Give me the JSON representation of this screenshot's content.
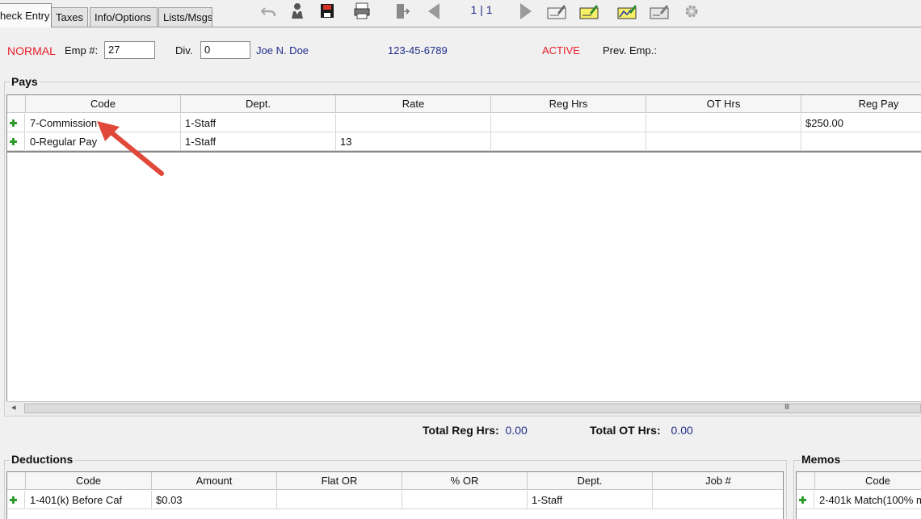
{
  "tabs": [
    {
      "label": "heck Entry",
      "active": true
    },
    {
      "label": "Taxes"
    },
    {
      "label": "Info/Options"
    },
    {
      "label": "Lists/Msgs"
    }
  ],
  "toolbar": {
    "pager": "1 | 1",
    "icons": [
      "undo-icon",
      "user-icon",
      "save-icon",
      "print-icon",
      "exit-icon",
      "prev-icon",
      "next-icon",
      "check-pen-icon",
      "check-highlight-icon",
      "check-chart-icon",
      "check-edit-icon",
      "gear-icon"
    ]
  },
  "employee": {
    "status": "NORMAL",
    "emp_label": "Emp #:",
    "emp_value": "27",
    "div_label": "Div.",
    "div_value": "0",
    "name": "Joe N. Doe",
    "ssn": "123-45-6789",
    "active": "ACTIVE",
    "prev_label": "Prev. Emp.:"
  },
  "pays": {
    "title": "Pays",
    "columns": [
      "Code",
      "Dept.",
      "Rate",
      "Reg Hrs",
      "OT Hrs",
      "Reg Pay"
    ],
    "rows": [
      [
        "7-Commission",
        "1-Staff",
        "",
        "",
        "",
        "$250.00"
      ],
      [
        "0-Regular Pay",
        "1-Staff",
        "13",
        "",
        "",
        ""
      ]
    ],
    "scroll_glyph": "III",
    "scroll_left": "◂",
    "total_reg_label": "Total Reg Hrs:",
    "total_reg_value": "0.00",
    "total_ot_label": "Total OT Hrs:",
    "total_ot_value": "0.00"
  },
  "deductions": {
    "title": "Deductions",
    "columns": [
      "Code",
      "Amount",
      "Flat OR",
      "% OR",
      "Dept.",
      "Job #"
    ],
    "rows": [
      [
        "1-401(k) Before Caf",
        "$0.03",
        "",
        "",
        "1-Staff",
        ""
      ]
    ]
  },
  "memos": {
    "title": "Memos",
    "columns": [
      "Code"
    ],
    "rows": [
      [
        "2-401k Match(100% m"
      ]
    ]
  },
  "colors": {
    "accent_red": "#e8202a",
    "text_blue": "#1f2d8a",
    "arrow": "#e0483a",
    "plus_green": "#2e9b2e"
  }
}
